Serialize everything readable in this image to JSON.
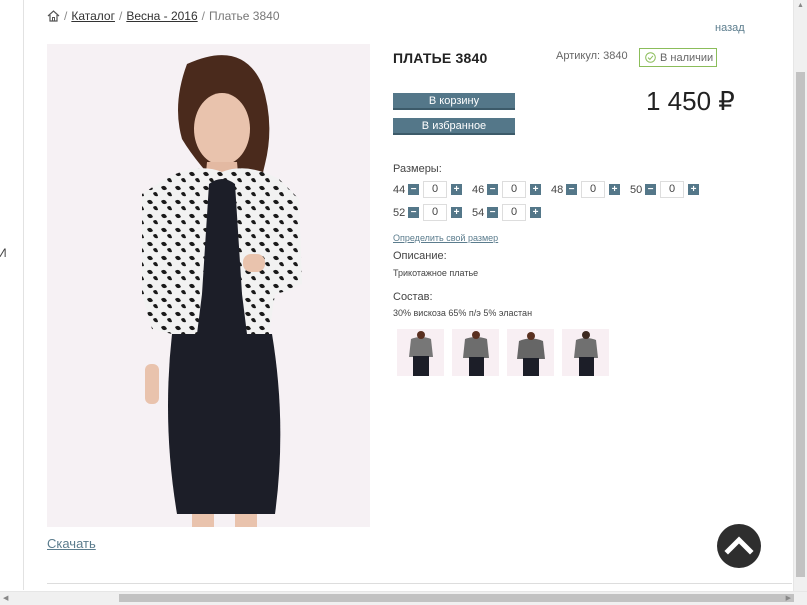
{
  "breadcrumb": {
    "items": [
      "Каталог",
      "Весна - 2016"
    ],
    "current": "Платье 3840"
  },
  "back_label": "назад",
  "product": {
    "title": "ПЛАТЬЕ 3840",
    "sku": "Артикул: 3840",
    "stock": "В наличии",
    "price": "1 450 ₽",
    "cart_label": "В корзину",
    "fav_label": "В избранное"
  },
  "sizes": {
    "label": "Размеры:",
    "row1": [
      {
        "size": "44",
        "qty": "0"
      },
      {
        "size": "46",
        "qty": "0"
      },
      {
        "size": "48",
        "qty": "0"
      },
      {
        "size": "50",
        "qty": "0"
      }
    ],
    "row2": [
      {
        "size": "52",
        "qty": "0"
      },
      {
        "size": "54",
        "qty": "0"
      }
    ],
    "minus": "−",
    "plus": "+"
  },
  "size_link": "Определить свой размер",
  "description": {
    "label": "Описание:",
    "text": "Трикотажное платье"
  },
  "composition": {
    "label": "Состав:",
    "text": "30% вискоза 65% п/э 5% эластан"
  },
  "download_label": "Скачать",
  "left_rail_char": "И",
  "colors": {
    "accent": "#547789",
    "link": "#5b7c8d",
    "stock_border": "#8bbd5a"
  }
}
